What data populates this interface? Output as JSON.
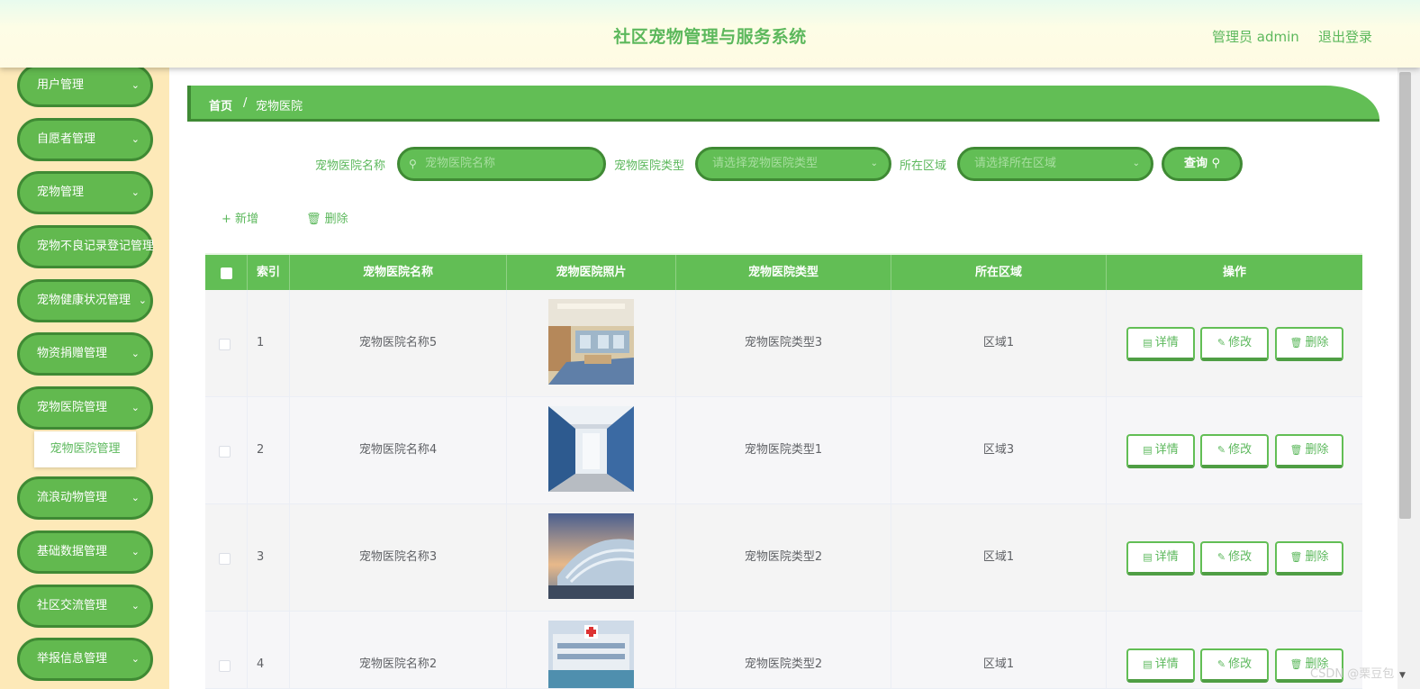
{
  "header": {
    "title": "社区宠物管理与服务系统",
    "user": "管理员 admin",
    "logout": "退出登录"
  },
  "sidebar": {
    "items": [
      {
        "label": "用户管理"
      },
      {
        "label": "自愿者管理"
      },
      {
        "label": "宠物管理"
      },
      {
        "label": "宠物不良记录登记管理"
      },
      {
        "label": "宠物健康状况管理"
      },
      {
        "label": "物资捐赠管理"
      },
      {
        "label": "宠物医院管理"
      },
      {
        "label": "流浪动物管理"
      },
      {
        "label": "基础数据管理"
      },
      {
        "label": "社区交流管理"
      },
      {
        "label": "举报信息管理"
      }
    ],
    "submenu_label": "宠物医院管理"
  },
  "breadcrumb": {
    "home": "首页",
    "separator": "/",
    "current": "宠物医院"
  },
  "search": {
    "name_label": "宠物医院名称",
    "name_placeholder": "宠物医院名称",
    "type_label": "宠物医院类型",
    "type_placeholder": "请选择宠物医院类型",
    "area_label": "所在区域",
    "area_placeholder": "请选择所在区域",
    "query_label": "查询"
  },
  "actions": {
    "add": "新增",
    "delete": "删除"
  },
  "table": {
    "headers": [
      "索引",
      "宠物医院名称",
      "宠物医院照片",
      "宠物医院类型",
      "所在区域",
      "操作"
    ],
    "rows": [
      {
        "index": "1",
        "name": "宠物医院名称5",
        "type": "宠物医院类型3",
        "area": "区域1"
      },
      {
        "index": "2",
        "name": "宠物医院名称4",
        "type": "宠物医院类型1",
        "area": "区域3"
      },
      {
        "index": "3",
        "name": "宠物医院名称3",
        "type": "宠物医院类型2",
        "area": "区域1"
      },
      {
        "index": "4",
        "name": "宠物医院名称2",
        "type": "宠物医院类型2",
        "area": "区域1"
      }
    ],
    "row_buttons": {
      "detail": "详情",
      "edit": "修改",
      "delete": "删除"
    }
  },
  "watermark": "CSDN @栗豆包",
  "colors": {
    "primary": "#62be55",
    "border": "#3f8a34",
    "sidebar_bg": "#fde9b8",
    "text_green": "#5cb85c"
  },
  "icons": [
    "search-icon",
    "chevron-down-icon",
    "plus-icon",
    "trash-icon",
    "document-icon",
    "pencil-icon"
  ]
}
